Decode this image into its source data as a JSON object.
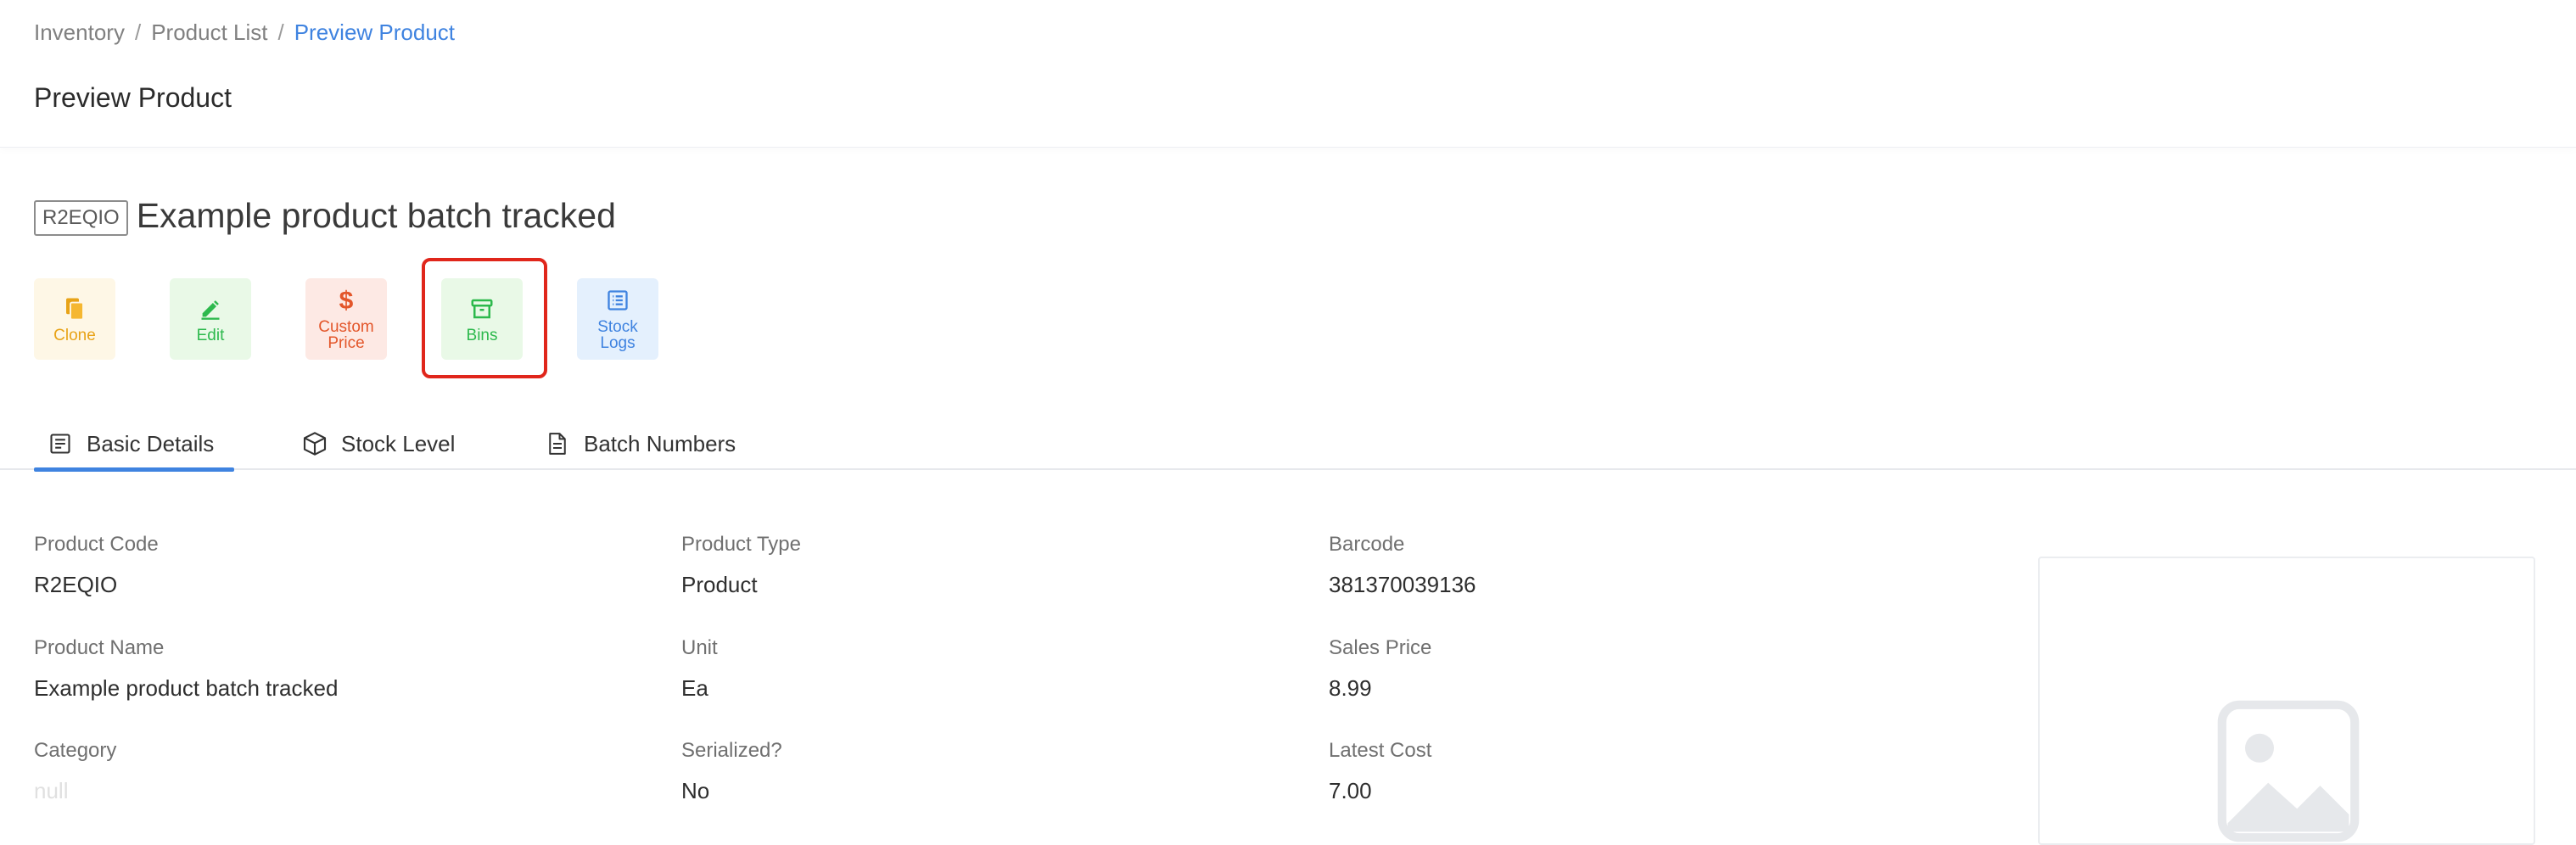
{
  "breadcrumb": {
    "items": [
      "Inventory",
      "Product List"
    ],
    "current": "Preview Product"
  },
  "header": {
    "title": "Preview Product"
  },
  "product": {
    "code_tag": "R2EQIO",
    "name": "Example product batch tracked"
  },
  "actions": {
    "clone": {
      "label": "Clone",
      "icon": "copy-icon"
    },
    "edit": {
      "label": "Edit",
      "icon": "pencil-icon"
    },
    "custom_price": {
      "label_line1": "Custom",
      "label_line2": "Price",
      "icon": "dollar-icon"
    },
    "bins": {
      "label": "Bins",
      "icon": "archive-box-icon"
    },
    "stock_logs": {
      "label_line1": "Stock",
      "label_line2": "Logs",
      "icon": "list-icon"
    }
  },
  "tabs": [
    {
      "label": "Basic Details",
      "icon": "document-list-icon",
      "active": true
    },
    {
      "label": "Stock Level",
      "icon": "cube-icon",
      "active": false
    },
    {
      "label": "Batch Numbers",
      "icon": "file-icon",
      "active": false
    }
  ],
  "details": {
    "product_code": {
      "label": "Product Code",
      "value": "R2EQIO"
    },
    "product_type": {
      "label": "Product Type",
      "value": "Product"
    },
    "barcode": {
      "label": "Barcode",
      "value": "381370039136"
    },
    "product_name": {
      "label": "Product Name",
      "value": "Example product batch tracked"
    },
    "unit": {
      "label": "Unit",
      "value": "Ea"
    },
    "sales_price": {
      "label": "Sales Price",
      "value": "8.99"
    },
    "category": {
      "label": "Category",
      "value": "null"
    },
    "serialized": {
      "label": "Serialized?",
      "value": "No"
    },
    "latest_cost": {
      "label": "Latest Cost",
      "value": "7.00"
    }
  },
  "image_placeholder": {
    "icon": "image-placeholder-icon"
  },
  "colors": {
    "accent_blue": "#3f83e0",
    "clone_yellow": "#e8a317",
    "edit_green": "#2db94d",
    "custom_price_red": "#e3562a",
    "highlight_red": "#e0261b"
  }
}
